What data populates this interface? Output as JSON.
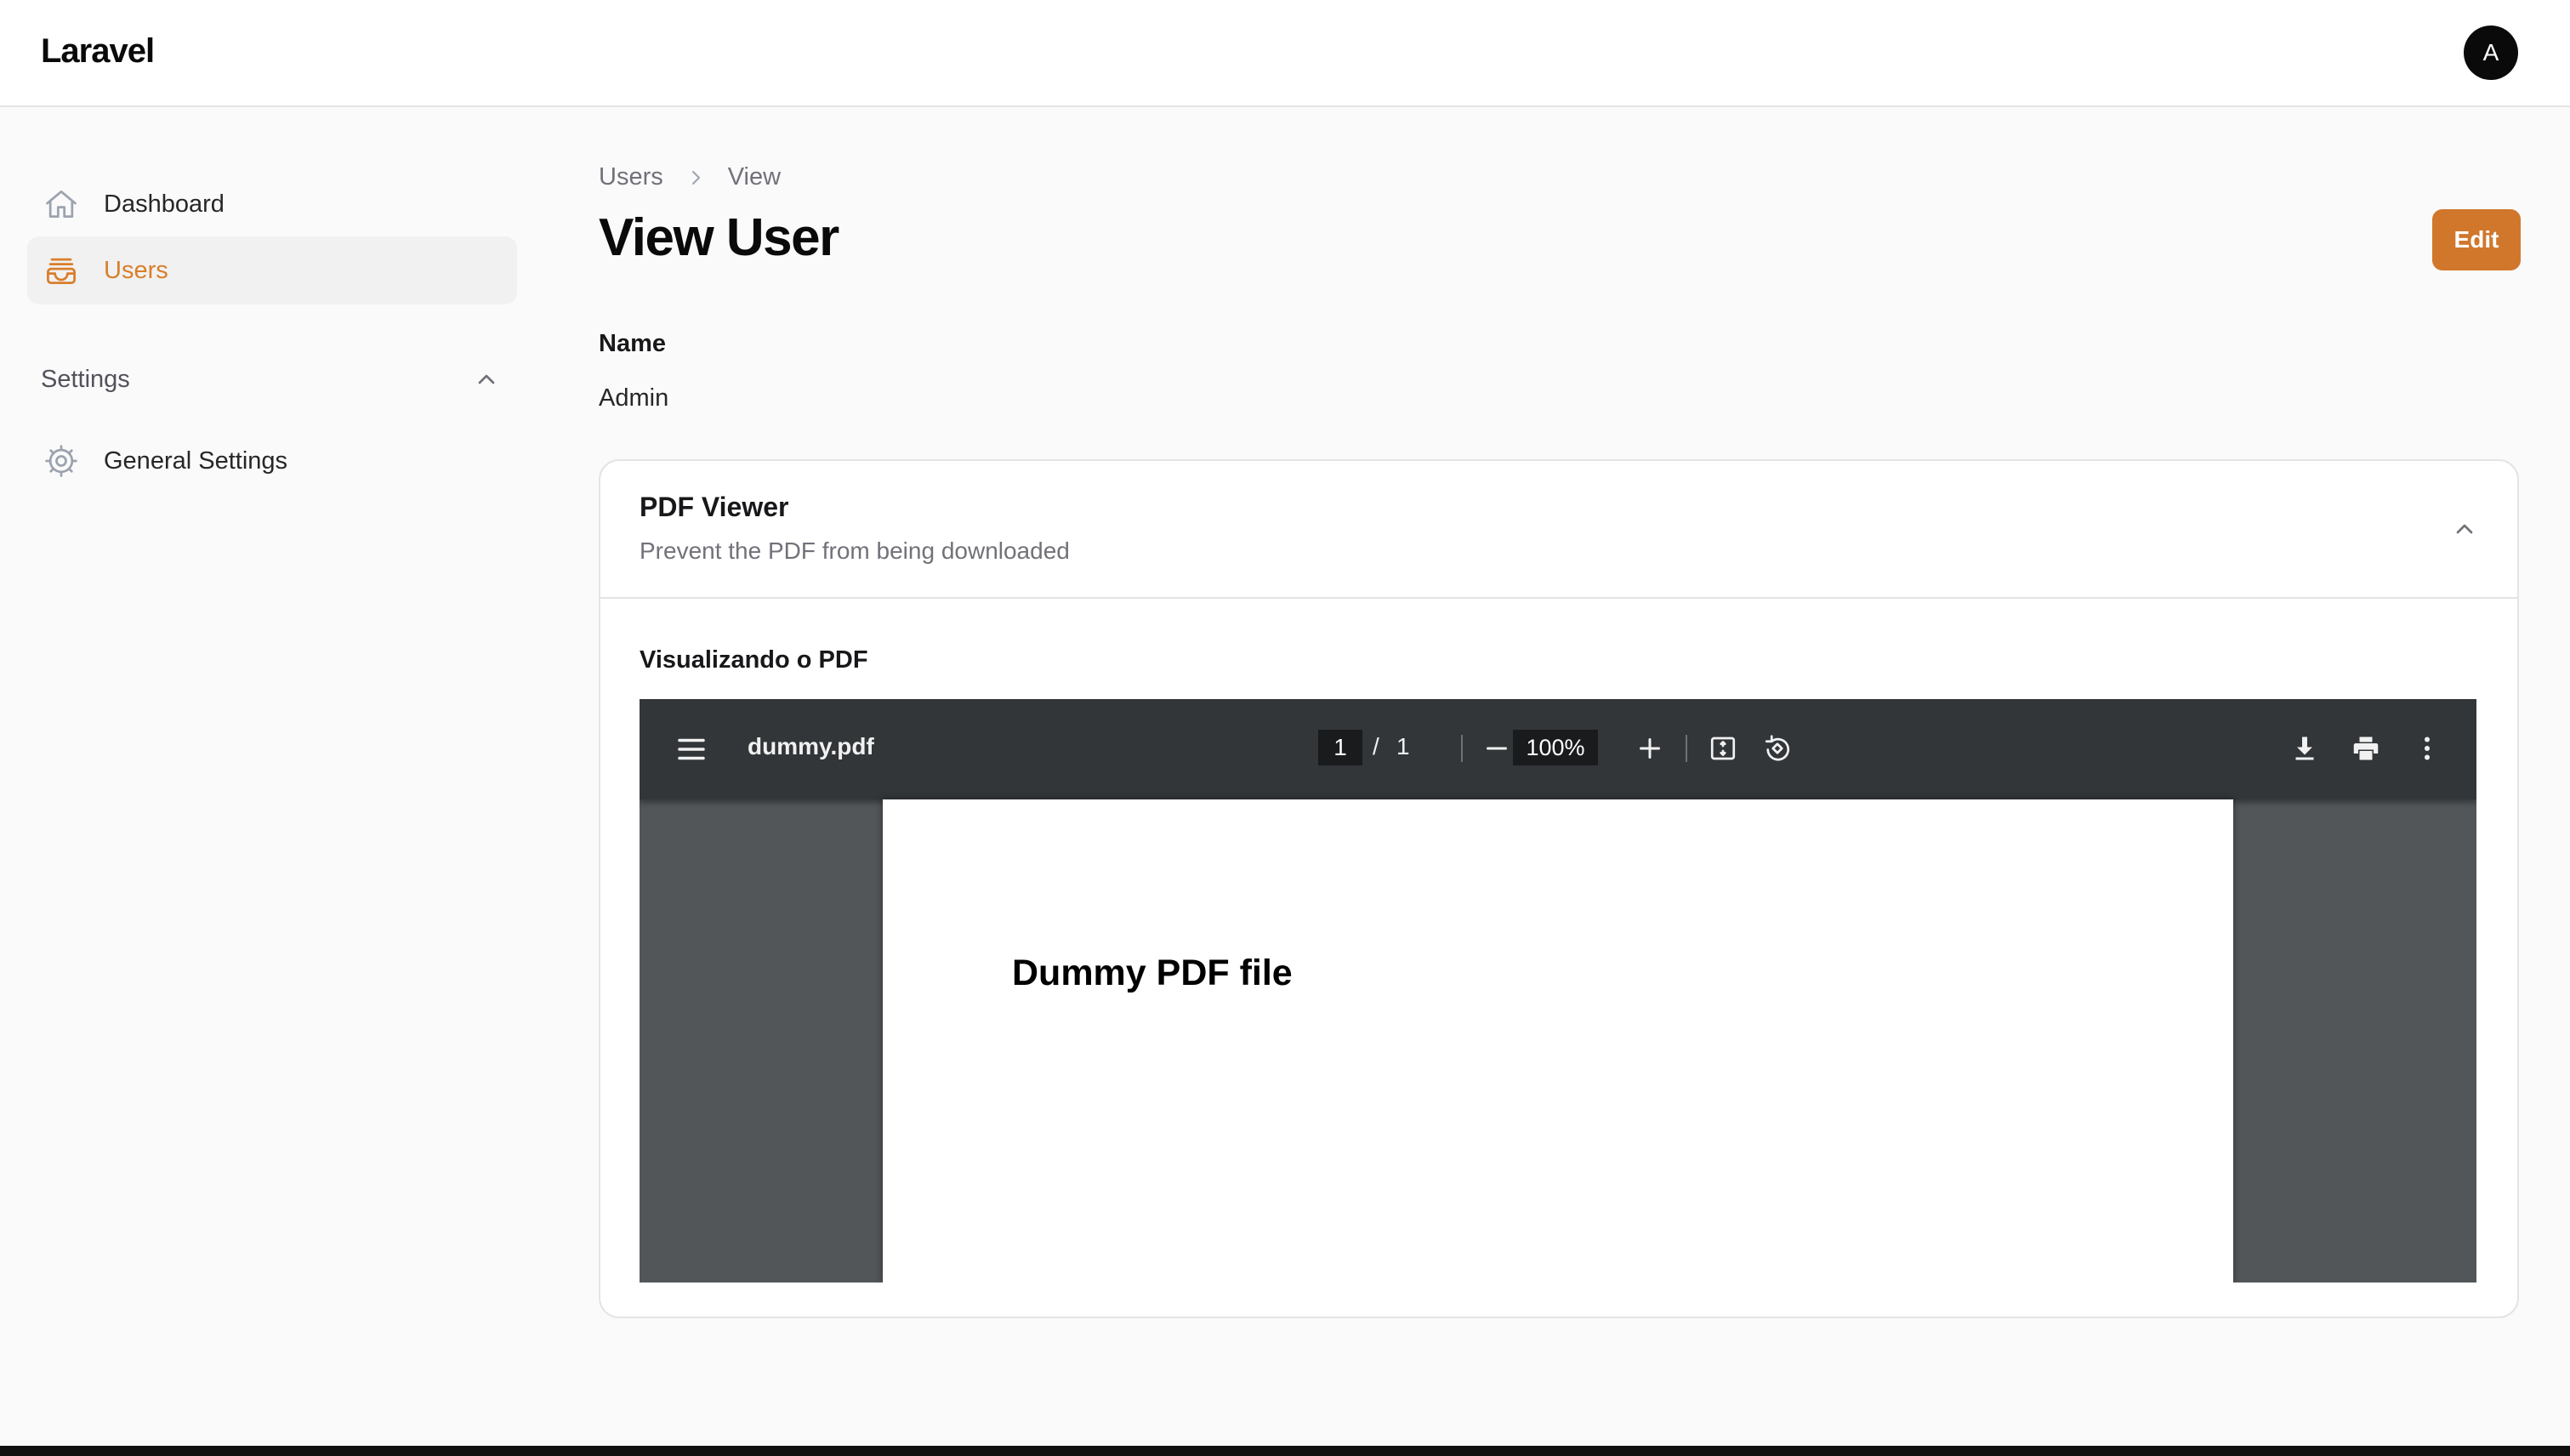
{
  "app": {
    "brand": "Laravel",
    "user_initial": "A"
  },
  "sidebar": {
    "items": [
      {
        "label": "Dashboard",
        "icon": "home-icon",
        "active": false
      },
      {
        "label": "Users",
        "icon": "inbox-stack-icon",
        "active": true
      }
    ],
    "groups": [
      {
        "label": "Settings",
        "expanded": true,
        "items": [
          {
            "label": "General Settings",
            "icon": "cog-icon"
          }
        ]
      }
    ]
  },
  "breadcrumb": [
    "Users",
    "View"
  ],
  "page": {
    "title": "View User",
    "edit_label": "Edit"
  },
  "fields": [
    {
      "label": "Name",
      "value": "Admin"
    }
  ],
  "section": {
    "title": "PDF Viewer",
    "description": "Prevent the PDF from being downloaded",
    "viewer_label": "Visualizando o PDF"
  },
  "pdf_viewer": {
    "filename": "dummy.pdf",
    "current_page": "1",
    "page_separator": "/",
    "total_pages": "1",
    "zoom": "100%",
    "document_heading": "Dummy PDF file"
  },
  "colors": {
    "accent": "#d0772b",
    "active_text": "#d97f2a",
    "viewer_toolbar": "#323639",
    "viewer_bg": "#525659"
  }
}
